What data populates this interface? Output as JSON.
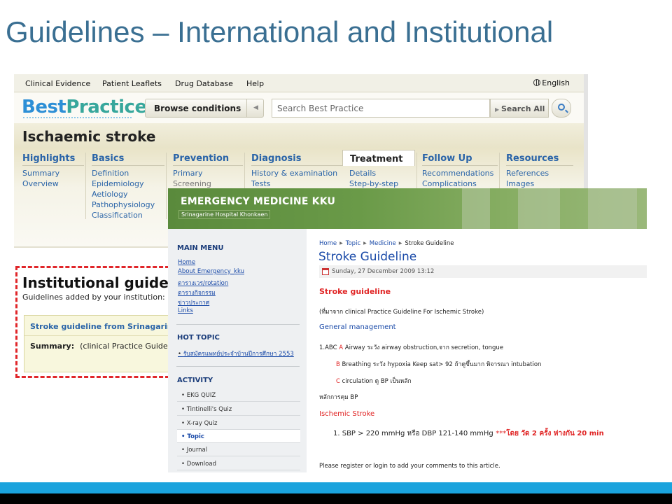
{
  "slide": {
    "title": "Guidelines – International and Institutional"
  },
  "bestpractice": {
    "topnav": [
      "Clinical Evidence",
      "Patient Leaflets",
      "Drug Database",
      "Help"
    ],
    "language": "English",
    "logo_best": "Best",
    "logo_practice": "Practice",
    "browse_label": "Browse conditions",
    "search_placeholder": "Search Best Practice",
    "search_all_label": "Search All",
    "condition_title": "Ischaemic stroke",
    "tabs": [
      {
        "heading": "Highlights",
        "items": [
          "Summary",
          "Overview"
        ]
      },
      {
        "heading": "Basics",
        "items": [
          "Definition",
          "Epidemiology",
          "Aetiology",
          "Pathophysiology",
          "Classification"
        ]
      },
      {
        "heading": "Prevention",
        "items": [
          "Primary",
          "Screening"
        ]
      },
      {
        "heading": "Diagnosis",
        "items": [
          "History & examination",
          "Tests"
        ]
      },
      {
        "heading": "Treatment",
        "items": [
          "Details",
          "Step-by-step"
        ]
      },
      {
        "heading": "Follow Up",
        "items": [
          "Recommendations",
          "Complications"
        ]
      },
      {
        "heading": "Resources",
        "items": [
          "References",
          "Images"
        ]
      }
    ],
    "institutional_title": "Institutional guideline",
    "institutional_sub": "Guidelines added by your institution: B",
    "guideline_link": "Stroke guideline from Srinagarine H",
    "summary_label": "Summary:",
    "summary_text": "(clinical Practice Guidel"
  },
  "emkku": {
    "site_name": "EMERGENCY MEDICINE KKU",
    "site_sub": "Srinagarine Hospital Khonkaen",
    "main_menu_heading": "MAIN MENU",
    "main_menu": [
      "Home",
      "About Emergency_kku",
      "ตารางเวร/rotation",
      "ตารางกิจกรรม",
      "ข่าวประกาศ",
      "Links"
    ],
    "hot_topic_heading": "HOT TOPIC",
    "hot_topic": "รับสมัครแพทย์ประจำบ้านปีการศึกษา 2553",
    "activity_heading": "ACTIVITY",
    "activity": [
      "EKG QUIZ",
      "Tintinelli's Quiz",
      "X-ray Quiz",
      "Topic",
      "Journal",
      "Download"
    ],
    "breadcrumb": [
      "Home",
      "Topic",
      "Medicine",
      "Stroke Guideline"
    ],
    "article_title": "Stroke Guideline",
    "article_date": "Sunday, 27 December 2009 13:12",
    "stroke_guideline_heading": "Stroke guideline",
    "source_line": "(ที่มาจาก clinical Practice Guideline For Ischemic Stroke)",
    "general_management": "General management",
    "abc_a_prefix": "1.ABC",
    "abc_a_letter": "A",
    "abc_a_text": "Airway ระวัง airway obstruction,จาก secretion, tongue",
    "abc_b_letter": "B",
    "abc_b_text": "Breathing ระวัง hypoxia Keep sat> 92 ถ้าดูขึ้นมาก พิจารณา intubation",
    "abc_c_letter": "C",
    "abc_c_text": "circulation ดู BP เป็นหลัก",
    "bp_principle": "หลักการคุม BP",
    "ischemic_stroke": "Ischemic Stroke",
    "sbp_line": "1. SBP > 220 mmHg หรือ DBP  121-140 mmHg",
    "sbp_stars": "***",
    "sbp_red": "โดย วัด 2 ครั้ง ห่างกัน 20 min",
    "register_note": "Please register or login to add your comments to this article."
  }
}
